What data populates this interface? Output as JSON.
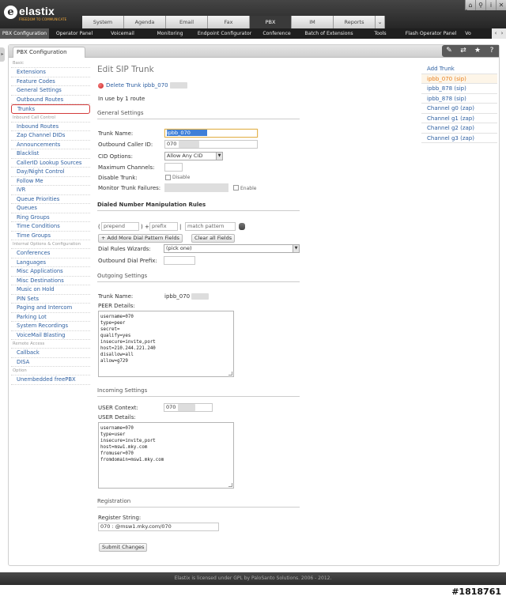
{
  "brand": {
    "name": "elastix",
    "tagline": "FREEDOM TO COMMUNICATE"
  },
  "top_icons": [
    "home-icon",
    "search-icon",
    "info-icon",
    "logout-icon"
  ],
  "main_tabs": [
    {
      "label": "System"
    },
    {
      "label": "Agenda"
    },
    {
      "label": "Email"
    },
    {
      "label": "Fax"
    },
    {
      "label": "PBX"
    },
    {
      "label": "IM"
    },
    {
      "label": "Reports"
    }
  ],
  "active_main_tab": "PBX",
  "module_tabs": [
    {
      "label": "PBX Configuration"
    },
    {
      "label": "Operator Panel"
    },
    {
      "label": "Voicemail"
    },
    {
      "label": "Monitoring"
    },
    {
      "label": "Endpoint Configurator"
    },
    {
      "label": "Conference"
    },
    {
      "label": "Batch of Extensions"
    },
    {
      "label": "Tools"
    },
    {
      "label": "Flash Operator Panel"
    },
    {
      "label": "Vo"
    }
  ],
  "frame_tab": "PBX Configuration",
  "sidebar": {
    "sections": [
      {
        "title": "Basic",
        "items": [
          "Extensions",
          "Feature Codes",
          "General Settings",
          "Outbound Routes",
          "Trunks"
        ]
      },
      {
        "title": "Inbound Call Control",
        "items": [
          "Inbound Routes",
          "Zap Channel DIDs",
          "Announcements",
          "Blacklist",
          "CallerID Lookup Sources",
          "Day/Night Control",
          "Follow Me",
          "IVR",
          "Queue Priorities",
          "Queues",
          "Ring Groups",
          "Time Conditions",
          "Time Groups"
        ]
      },
      {
        "title": "Internal Options & Configuration",
        "items": [
          "Conferences",
          "Languages",
          "Misc Applications",
          "Misc Destinations",
          "Music on Hold",
          "PIN Sets",
          "Paging and Intercom",
          "Parking Lot",
          "System Recordings",
          "VoiceMail Blasting"
        ]
      },
      {
        "title": "Remote Access",
        "items": [
          "Callback",
          "DISA"
        ]
      },
      {
        "title": "Option",
        "items": [
          "Unembedded freePBX"
        ]
      }
    ],
    "active": "Trunks"
  },
  "form": {
    "page_title": "Edit SIP Trunk",
    "delete_link": "Delete Trunk ipbb_070",
    "in_use": "In use by 1 route",
    "general_settings": "General Settings",
    "trunk_name_label": "Trunk Name:",
    "trunk_name_value": "ipbb_070",
    "outbound_cid_label": "Outbound Caller ID:",
    "outbound_cid_value": "070",
    "cid_options_label": "CID Options:",
    "cid_options_value": "Allow Any CID",
    "max_channels_label": "Maximum Channels:",
    "disable_trunk_label": "Disable Trunk:",
    "disable_checkbox_label": "Disable",
    "monitor_label": "Monitor Trunk Failures:",
    "enable_checkbox_label": "Enable",
    "dialed_title": "Dialed Number Manipulation Rules",
    "prepend_open": "(",
    "prepend_placeholder": "prepend",
    "prepend_close": ") +",
    "prefix_placeholder": "prefix",
    "prefix_close": "|",
    "match_placeholder": "match pattern",
    "add_more_button": "+ Add More Dial Pattern Fields",
    "clear_all_button": "Clear all Fields",
    "dial_wizard_label": "Dial Rules Wizards:",
    "dial_wizard_value": "(pick one)",
    "outbound_prefix_label": "Outbound Dial Prefix:",
    "outgoing_settings": "Outgoing Settings",
    "out_trunk_name_label": "Trunk Name:",
    "out_trunk_name_value": "ipbb_070",
    "peer_details_label": "PEER Details:",
    "peer_details": "username=070\ntype=peer\nsecret=\nqualify=yes\ninsecure=invite,port\nhost=210.244.221.240\ndisallow=all\nallow=g729",
    "incoming_settings": "Incoming Settings",
    "user_context_label": "USER Context:",
    "user_context_value": "070",
    "user_details_label": "USER Details:",
    "user_details": "username=070\ntype=user\ninsecure=invite,port\nhost=msw1.mky.com\nfromuser=070\nfromdomain=msw1.mky.com",
    "registration": "Registration",
    "register_string_label": "Register String:",
    "register_string_value": "070          :          @msw1.mky.com/070",
    "submit_button": "Submit Changes"
  },
  "trunk_list": [
    {
      "label": "Add Trunk"
    },
    {
      "label": "ipbb_070           (sip)"
    },
    {
      "label": "ipbb_878           (sip)"
    },
    {
      "label": "ipbb_878           (sip)"
    },
    {
      "label": "Channel g0 (zap)"
    },
    {
      "label": "Channel g1 (zap)"
    },
    {
      "label": "Channel g2 (zap)"
    },
    {
      "label": "Channel g3 (zap)"
    }
  ],
  "footer": "Elastix is licensed under GPL by PaloSanto Solutions. 2006 - 2012.",
  "watermark": "#1818761",
  "colors": {
    "link": "#2d5fa1",
    "active_trunk": "#e8801e",
    "header": "#2b2b2b",
    "active_sidebar_border": "#d33b3b"
  }
}
